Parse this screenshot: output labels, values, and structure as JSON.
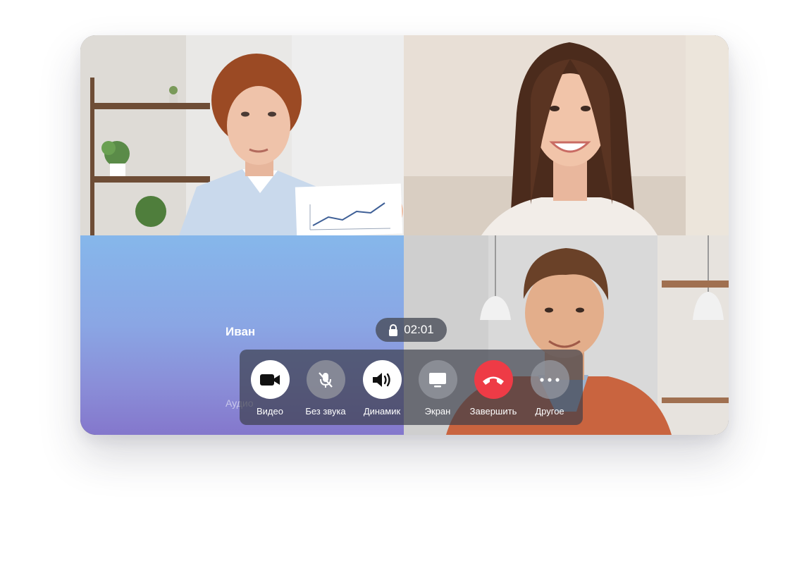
{
  "call": {
    "timer": "02:01",
    "audio_participant": {
      "name": "Иван",
      "subtitle": "Аудио"
    }
  },
  "controls": [
    {
      "id": "video",
      "label": "Видео",
      "icon": "video-camera-icon",
      "style": "white"
    },
    {
      "id": "mute",
      "label": "Без звука",
      "icon": "mic-off-icon",
      "style": "grey"
    },
    {
      "id": "speaker",
      "label": "Динамик",
      "icon": "speaker-icon",
      "style": "white"
    },
    {
      "id": "screen",
      "label": "Экран",
      "icon": "monitor-icon",
      "style": "grey"
    },
    {
      "id": "end",
      "label": "Завершить",
      "icon": "hang-up-icon",
      "style": "red"
    },
    {
      "id": "more",
      "label": "Другое",
      "icon": "more-dots-icon",
      "style": "grey"
    }
  ],
  "colors": {
    "end_call": "#ee3b46",
    "audio_tile_top": "#86b7eb",
    "audio_tile_bottom": "#8477cc"
  }
}
